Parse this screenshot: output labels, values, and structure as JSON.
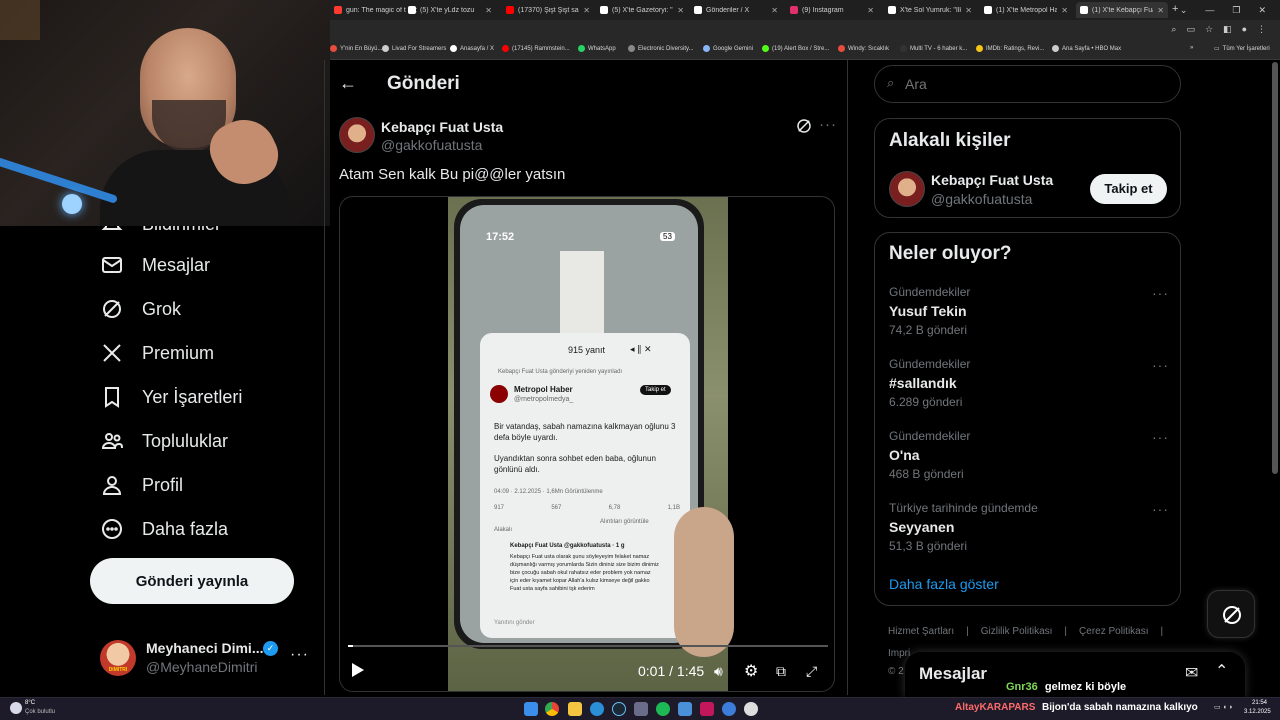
{
  "browser": {
    "tabs": [
      {
        "label": "gun: The magic of t",
        "color": "#ff3b30"
      },
      {
        "label": "(5) X'te yLdz tozu",
        "color": "#ffffff"
      },
      {
        "label": "(17370) Şişt Şişt sakin",
        "color": "#ff0000"
      },
      {
        "label": "(5) X'te Gazetoryi: \"iPh",
        "color": "#ffffff"
      },
      {
        "label": "Gönderiler / X",
        "color": "#ffffff"
      },
      {
        "label": "(9) Instagram",
        "color": "#e1306c"
      },
      {
        "label": "X'te Sol Yumruk: \"İlk s",
        "color": "#ffffff"
      },
      {
        "label": "(1) X'te Metropol Hab",
        "color": "#ffffff"
      },
      {
        "label": "(1) X'te Kebapçı Fuat U",
        "color": "#ffffff"
      }
    ],
    "bookmarks": [
      {
        "label": "Y'nin En Büyü...",
        "color": "#e74c3c"
      },
      {
        "label": "Livad For Streamers",
        "color": "#cccccc"
      },
      {
        "label": "Anasayfa / X",
        "color": "#ffffff"
      },
      {
        "label": "(17145) Rammstein...",
        "color": "#ff0000"
      },
      {
        "label": "WhatsApp",
        "color": "#25d366"
      },
      {
        "label": "Electronic Diversity...",
        "color": "#888888"
      },
      {
        "label": "Google Gemini",
        "color": "#8ab4f8"
      },
      {
        "label": "(19) Alert Box / Stre...",
        "color": "#53fc18"
      },
      {
        "label": "Windy: Sıcaklık",
        "color": "#e74c3c"
      },
      {
        "label": "Multi TV - 6 haber k...",
        "color": "#333333"
      },
      {
        "label": "IMDb: Ratings, Revi...",
        "color": "#f5c518"
      },
      {
        "label": "Ana Sayfa • HBO Max",
        "color": "#cccccc"
      }
    ],
    "all_bookmarks": "Tüm Yer İşaretleri"
  },
  "nav": {
    "notifications_label": "Bildirimler",
    "items": [
      {
        "label": "Mesajlar",
        "icon": "mail-icon"
      },
      {
        "label": "Grok",
        "icon": "grok-icon"
      },
      {
        "label": "Premium",
        "icon": "x-logo-icon"
      },
      {
        "label": "Yer İşaretleri",
        "icon": "bookmark-icon"
      },
      {
        "label": "Topluluklar",
        "icon": "communities-icon"
      },
      {
        "label": "Profil",
        "icon": "profile-icon"
      },
      {
        "label": "Daha fazla",
        "icon": "more-circle-icon"
      }
    ],
    "post_button": "Gönderi yayınla",
    "account": {
      "name": "Meyhaneci Dimi...",
      "handle": "@MeyhaneDimitri",
      "avatar_text": "DIMITRI"
    }
  },
  "header": {
    "title": "Gönderi"
  },
  "tweet": {
    "author": "Kebapçı Fuat Usta",
    "handle": "@gakkofuatusta",
    "text": "Atam Sen kalk Bu pi@@ler yatsın",
    "video": {
      "time": "0:01 / 1:45",
      "progress": 0.01,
      "phone_time": "17:52",
      "battery": "53",
      "replies": "915 yanıt",
      "repost_note": "Kebapçı Fuat Usta gönderiyi yeniden yayınladı",
      "inner_author": "Metropol Haber",
      "inner_handle": "@metropolmedya_",
      "inner_follow": "Takip et",
      "inner_text1": "Bir vatandaş, sabah namazına kalkmayan oğlunu 3 defa böyle uyardı.",
      "inner_text2": "Uyandıktan sonra sohbet eden baba, oğlunun gönlünü aldı.",
      "inner_meta": "04:09 · 2.12.2025 · 1,6Mn Görüntülenme",
      "stats": [
        "917",
        "567",
        "6,78",
        "1,1B"
      ],
      "related": "Alakalı",
      "recent": "Alıntıları görüntüle",
      "reply_author": "Kebapçı Fuat Usta @gakkofuatusta · 1 g",
      "reply_text": "Kebapçı Fuat usta olarak şunu söyleyeyim felaket namaz düşmanlığı varmış yorumlarda Sizin dininiz size bizim dinimiz bize çocuğu sabah okul rahatsız eder problem yok namaz için eder kıyamet kopar Allah'a kulsz kimseye değil gakko Fuat usta sayfa sahibini tşk ederim",
      "reply_prompt": "Yanıtını gönder"
    }
  },
  "sidebar": {
    "search_placeholder": "Ara",
    "related_title": "Alakalı kişiler",
    "related_person": {
      "name": "Kebapçı Fuat Usta",
      "handle": "@gakkofuatusta",
      "follow": "Takip et"
    },
    "trends_title": "Neler oluyor?",
    "trends": [
      {
        "meta": "Gündemdekiler",
        "name": "Yusuf Tekin",
        "count": "74,2 B gönderi"
      },
      {
        "meta": "Gündemdekiler",
        "name": "#sallandık",
        "count": "6.289 gönderi"
      },
      {
        "meta": "Gündemdekiler",
        "name": "O'na",
        "count": "468 B gönderi"
      },
      {
        "meta": "Türkiye tarihinde gündemde",
        "name": "Seyyanen",
        "count": "51,3 B gönderi"
      }
    ],
    "show_more": "Daha fazla göster",
    "footer": [
      "Hizmet Şartları",
      "Gizlilik Politikası",
      "Çerez Politikası"
    ],
    "footer_more": "Impri",
    "footer_copy": "© 2"
  },
  "messages_dock": {
    "title": "Mesajlar"
  },
  "chat_overlay": {
    "user": "Gnr36",
    "text": "gelmez ki böyle"
  },
  "taskbar": {
    "weather_temp": "8°C",
    "weather_desc": "Çok bulutlu",
    "ticker_user": "AltayKARAPARS",
    "ticker_text": "Bijon'da sabah namazına kalkıyo",
    "clock_time": "21:54",
    "clock_date": "3.12.2025"
  },
  "colors": {
    "accent": "#1d9bf0",
    "bg": "#000000",
    "border": "#2f3336",
    "muted": "#71767b"
  }
}
